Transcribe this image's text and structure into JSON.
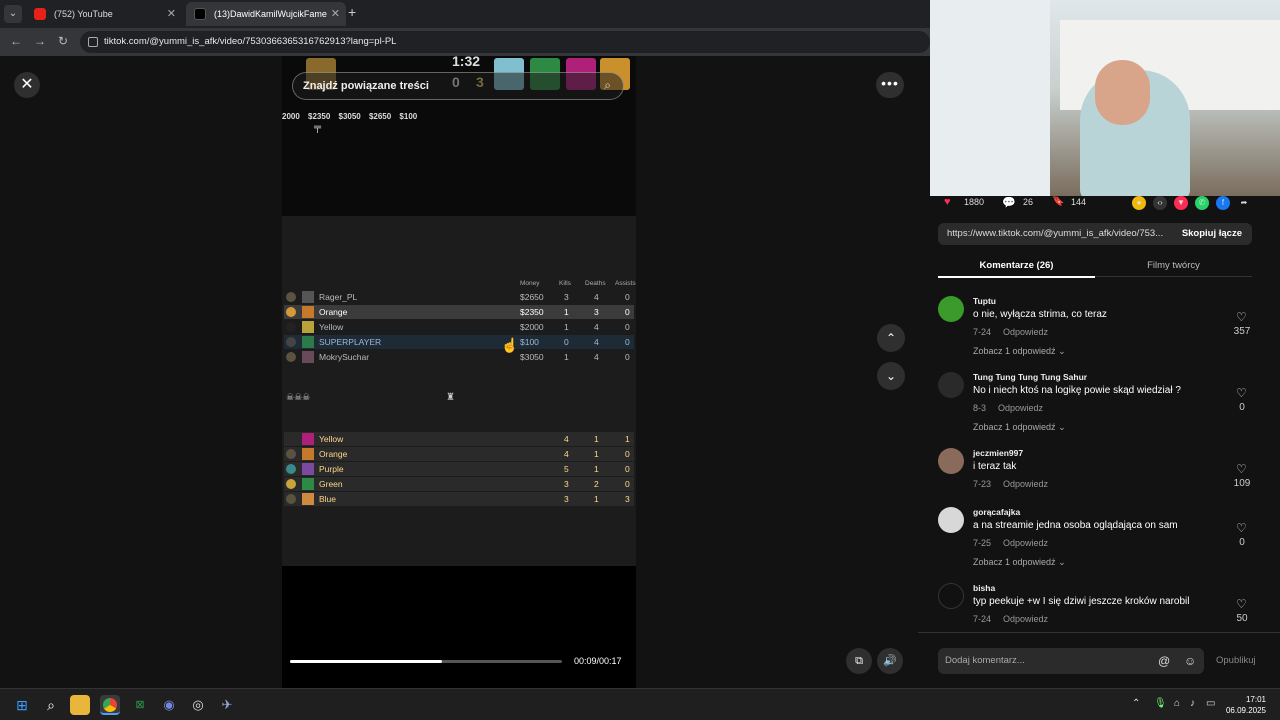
{
  "browser": {
    "tabs": [
      {
        "title": "(752) YouTube",
        "active": false
      },
      {
        "title": "(13)DawidKamilWujcikFame",
        "active": true
      }
    ],
    "url": "tiktok.com/@yummi_is_afk/video/7530366365316762913?lang=pl-PL"
  },
  "video": {
    "search_label": "Znajdź powiązane treści",
    "hud_time": "1:32",
    "hud_score_left": "0",
    "hud_score_right": "3",
    "prices": "2000 $2350 $3050 $2650 $100",
    "columns": {
      "money": "Money",
      "kills": "Kills",
      "deaths": "Deaths",
      "assists": "Assists"
    },
    "players": [
      {
        "name": "Rager_PL",
        "money": "$2650",
        "kills": "3",
        "deaths": "4",
        "assists": "0"
      },
      {
        "name": "Orange",
        "money": "$2350",
        "kills": "1",
        "deaths": "3",
        "assists": "0"
      },
      {
        "name": "Yellow",
        "money": "$2000",
        "kills": "1",
        "deaths": "4",
        "assists": "0"
      },
      {
        "name": "SUPERPLAYER",
        "money": "$100",
        "kills": "0",
        "deaths": "4",
        "assists": "0"
      },
      {
        "name": "MokrySuchar",
        "money": "$3050",
        "kills": "1",
        "deaths": "4",
        "assists": "0"
      }
    ],
    "team": [
      {
        "name": "Yellow",
        "kills": "4",
        "deaths": "1",
        "assists": "1"
      },
      {
        "name": "Orange",
        "kills": "4",
        "deaths": "1",
        "assists": "0"
      },
      {
        "name": "Purple",
        "kills": "5",
        "deaths": "1",
        "assists": "0"
      },
      {
        "name": "Green",
        "kills": "3",
        "deaths": "2",
        "assists": "0"
      },
      {
        "name": "Blue",
        "kills": "3",
        "deaths": "1",
        "assists": "3"
      }
    ],
    "time": "00:09/00:17",
    "progress": 0.56
  },
  "panel": {
    "likes": "1880",
    "comments_count": "26",
    "saves": "144",
    "link": "https://www.tiktok.com/@yummi_is_afk/video/753...",
    "copy_label": "Skopiuj łącze",
    "tab_comments": "Komentarze (26)",
    "tab_creator": "Filmy twórcy",
    "comments": [
      {
        "user": "Tuptu",
        "text": "o nie, wyłącza strima, co teraz",
        "date": "7-24",
        "reply": "Odpowiedz",
        "likes": "357",
        "replies": "Zobacz 1 odpowiedź"
      },
      {
        "user": "Tung Tung Tung Tung Sahur",
        "text": "No i niech ktoś na logikę powie skąd wiedział ?",
        "date": "8-3",
        "reply": "Odpowiedz",
        "likes": "0",
        "replies": "Zobacz 1 odpowiedź"
      },
      {
        "user": "jeczmien997",
        "text": "i teraz tak",
        "date": "7-23",
        "reply": "Odpowiedz",
        "likes": "109",
        "replies": ""
      },
      {
        "user": "gorącafajka",
        "text": "a na streamie jedna osoba oglądająca on sam",
        "date": "7-25",
        "reply": "Odpowiedz",
        "likes": "0",
        "replies": "Zobacz 1 odpowiedź"
      },
      {
        "user": "bisha",
        "text": "typ peekuje +w I się dziwi jeszcze kroków narobil",
        "date": "7-24",
        "reply": "Odpowiedz",
        "likes": "50",
        "replies": ""
      }
    ],
    "input_placeholder": "Dodaj komentarz...",
    "publish": "Opublikuj"
  },
  "taskbar": {
    "time": "17:01",
    "date": "06.09.2025"
  }
}
